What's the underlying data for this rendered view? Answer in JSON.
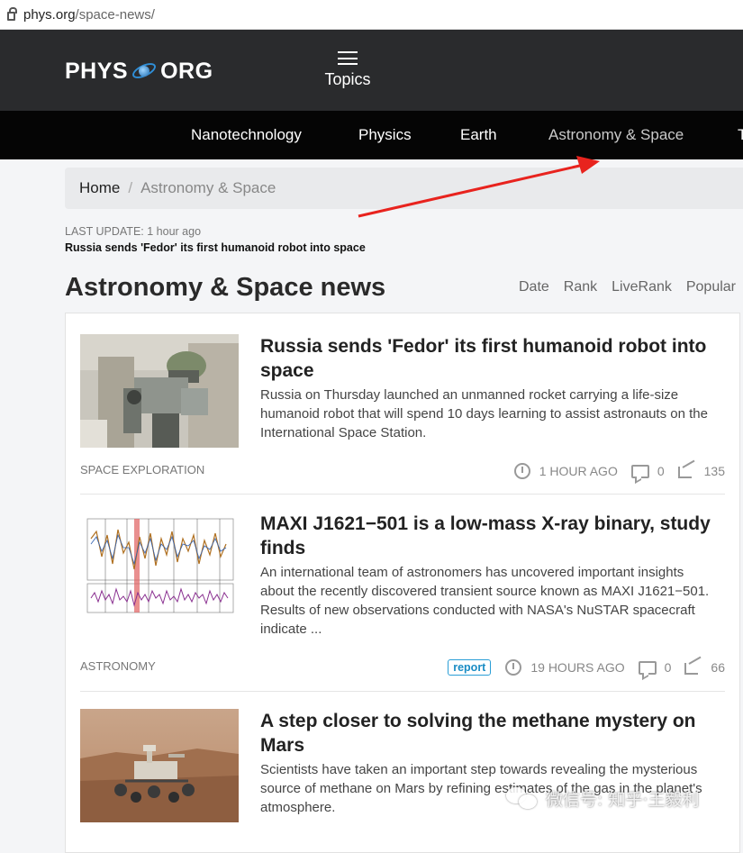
{
  "browser": {
    "url_domain": "phys.org",
    "url_path": "/space-news/"
  },
  "header": {
    "logo_left": "PHYS",
    "logo_right": "ORG",
    "topics_label": "Topics"
  },
  "nav": {
    "items": [
      {
        "label": "Nanotechnology"
      },
      {
        "label": "Physics"
      },
      {
        "label": "Earth"
      },
      {
        "label": "Astronomy & Space"
      },
      {
        "label": "T"
      }
    ]
  },
  "breadcrumb": {
    "home": "Home",
    "separator": "/",
    "current": "Astronomy & Space"
  },
  "last_update": {
    "label": "LAST UPDATE:",
    "value": "1 hour ago",
    "headline": "Russia sends 'Fedor' its first humanoid robot into space"
  },
  "section": {
    "title": "Astronomy & Space news",
    "sort_tabs": [
      "Date",
      "Rank",
      "LiveRank",
      "Popular"
    ]
  },
  "articles": [
    {
      "title": "Russia sends 'Fedor' its first humanoid robot into space",
      "summary": "Russia on Thursday launched an unmanned rocket carrying a life-size humanoid robot that will spend 10 days learning to assist astronauts on the International Space Station.",
      "category": "SPACE EXPLORATION",
      "time": "1 HOUR AGO",
      "comments": "0",
      "shares": "135"
    },
    {
      "title": "MAXI J1621−501 is a low-mass X-ray binary, study finds",
      "summary": "An international team of astronomers has uncovered important insights about the recently discovered transient source known as MAXI J1621−501. Results of new observations conducted with NASA's NuSTAR spacecraft indicate ...",
      "category": "ASTRONOMY",
      "badge": "report",
      "time": "19 HOURS AGO",
      "comments": "0",
      "shares": "66"
    },
    {
      "title": "A step closer to solving the methane mystery on Mars",
      "summary": "Scientists have taken an important step towards revealing the mysterious source of methane on Mars by refining estimates of the gas in the planet's atmosphere."
    }
  ],
  "watermark": {
    "text": "微信号: 知乎·王毅利"
  },
  "colors": {
    "header_bg": "#2a2b2d",
    "nav_bg": "#050505",
    "logo_blue": "#2f8fd8",
    "badge_blue": "#1a8cc4",
    "annotation_red": "#e8231e"
  }
}
